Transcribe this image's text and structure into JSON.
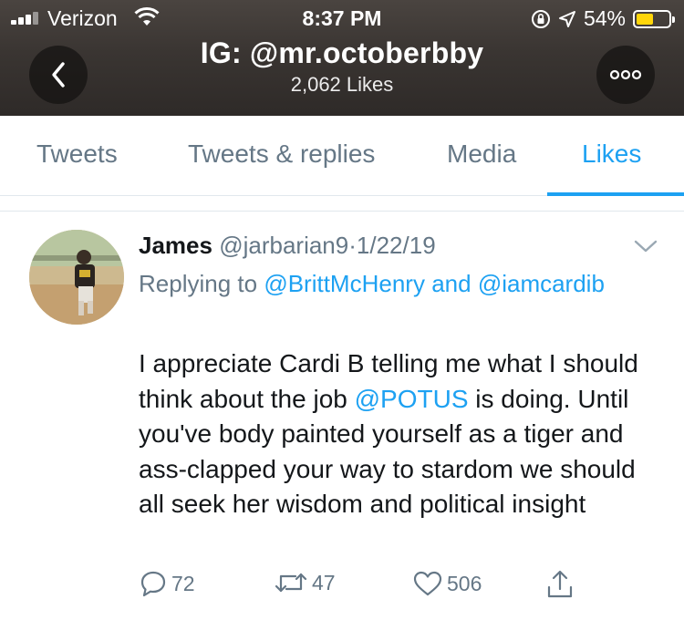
{
  "status_bar": {
    "carrier": "Verizon",
    "time": "8:37 PM",
    "battery_text": "54%",
    "battery_level": 0.54,
    "battery_color": "#ffd60a",
    "icons": [
      "signal-icon",
      "wifi-icon",
      "rotation-lock-icon",
      "location-icon",
      "battery-icon"
    ]
  },
  "profile": {
    "title": "IG: @mr.octoberbby",
    "subtitle": "2,062 Likes"
  },
  "tabs": [
    {
      "label": "Tweets",
      "active": false
    },
    {
      "label": "Tweets & replies",
      "active": false
    },
    {
      "label": "Media",
      "active": false
    },
    {
      "label": "Likes",
      "active": true
    }
  ],
  "colors": {
    "accent": "#1da1f2",
    "secondary_text": "#657786",
    "primary_text": "#14171a"
  },
  "tweet": {
    "name": "James",
    "handle": "@jarbarian9",
    "separator": "·",
    "date": "1/22/19",
    "replying_prefix": "Replying to",
    "mention_1": "@BrittMcHenry",
    "replying_and": "and",
    "mention_2": "@iamcardib",
    "body_part_1": "I appreciate Cardi B telling me what I should think about the job",
    "body_mention": "@POTUS",
    "body_part_2": "is doing. Until you've body painted yourself as a tiger and ass-clapped your way to stardom we should all seek her wisdom and political insight",
    "replies": "72",
    "retweets": "47",
    "likes": "506"
  }
}
